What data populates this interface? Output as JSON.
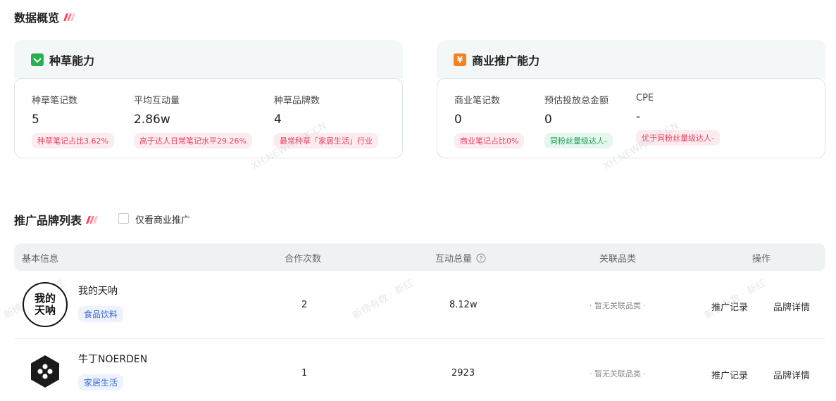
{
  "overview": {
    "title": "数据概览"
  },
  "seeding": {
    "title": "种草能力",
    "icon": "check-icon",
    "color": "#27b052",
    "metrics": [
      {
        "label": "种草笔记数",
        "value": "5",
        "tag": "种草笔记占比3.62%"
      },
      {
        "label": "平均互动量",
        "value": "2.86w",
        "tag": "高于达人日常笔记水平29.26%"
      },
      {
        "label": "种草品牌数",
        "value": "4",
        "tag": "最常种草「家居生活」行业"
      }
    ]
  },
  "commerce": {
    "title": "商业推广能力",
    "icon": "yen-icon",
    "icon_glyph": "¥",
    "color": "#f58220",
    "metrics": [
      {
        "label": "商业笔记数",
        "value": "0",
        "tag": "商业笔记占比0%"
      },
      {
        "label": "预估投放总金额",
        "value": "0",
        "tag": "同粉丝量级达人-"
      },
      {
        "label": "CPE",
        "value": "-",
        "tag": "优于同粉丝量级达人-"
      }
    ]
  },
  "watermark": {
    "text1": "XH.NEWRANK.CN",
    "text2": "新榜有数 · 新红"
  },
  "brand_list": {
    "title": "推广品牌列表",
    "filter_label": "仅看商业推广",
    "columns": [
      "基本信息",
      "合作次数",
      "互动总量",
      "关联品类",
      "操作"
    ],
    "rows": [
      {
        "logo_text": "我的天呐",
        "name": "我的天呐",
        "category": "食品饮料",
        "count": "2",
        "interactions": "8.12w",
        "related": "· 暂无关联品类 ·",
        "action1": "推广记录",
        "action2": "品牌详情"
      },
      {
        "name": "牛丁NOERDEN",
        "category": "家居生活",
        "count": "1",
        "interactions": "2923",
        "related": "· 暂无关联品类 ·",
        "action1": "推广记录",
        "action2": "品牌详情"
      }
    ]
  }
}
